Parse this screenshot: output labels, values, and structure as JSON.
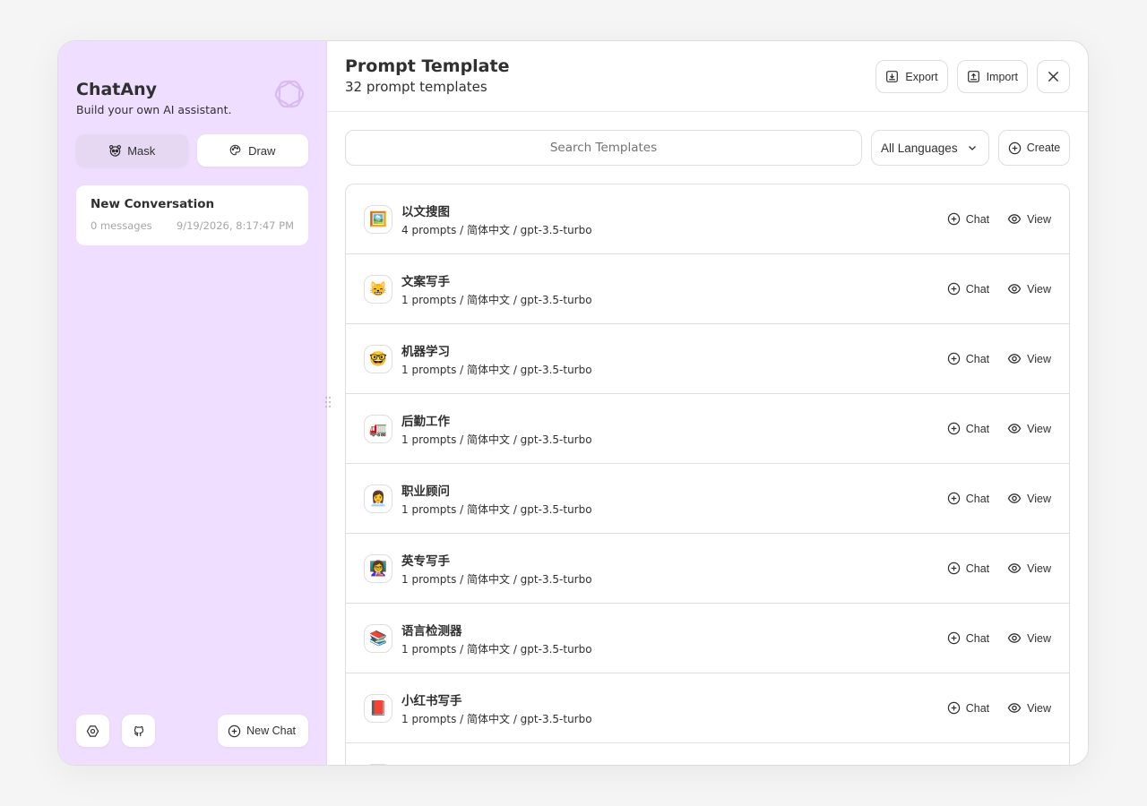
{
  "sidebar": {
    "title": "ChatAny",
    "subtitle": "Build your own AI assistant.",
    "mask_label": "Mask",
    "draw_label": "Draw",
    "conversation": {
      "title": "New Conversation",
      "count": "0 messages",
      "time": "9/19/2026, 8:17:47 PM"
    },
    "new_chat_label": "New Chat"
  },
  "header": {
    "title": "Prompt Template",
    "subtitle": "32 prompt templates",
    "export_label": "Export",
    "import_label": "Import"
  },
  "toolbar": {
    "search_placeholder": "Search Templates",
    "language": "All Languages",
    "create_label": "Create"
  },
  "templates": [
    {
      "icon": "🖼️",
      "name": "以文搜图",
      "meta": "4 prompts / 简体中文 / gpt-3.5-turbo"
    },
    {
      "icon": "😸",
      "name": "文案写手",
      "meta": "1 prompts / 简体中文 / gpt-3.5-turbo"
    },
    {
      "icon": "🤓",
      "name": "机器学习",
      "meta": "1 prompts / 简体中文 / gpt-3.5-turbo"
    },
    {
      "icon": "🚛",
      "name": "后勤工作",
      "meta": "1 prompts / 简体中文 / gpt-3.5-turbo"
    },
    {
      "icon": "👩‍💼",
      "name": "职业顾问",
      "meta": "1 prompts / 简体中文 / gpt-3.5-turbo"
    },
    {
      "icon": "👩‍🏫",
      "name": "英专写手",
      "meta": "1 prompts / 简体中文 / gpt-3.5-turbo"
    },
    {
      "icon": "📚",
      "name": "语言检测器",
      "meta": "1 prompts / 简体中文 / gpt-3.5-turbo"
    },
    {
      "icon": "📕",
      "name": "小红书写手",
      "meta": "1 prompts / 简体中文 / gpt-3.5-turbo"
    },
    {
      "icon": "📝",
      "name": "",
      "meta": ""
    }
  ],
  "row_actions": {
    "chat_label": "Chat",
    "view_label": "View"
  }
}
